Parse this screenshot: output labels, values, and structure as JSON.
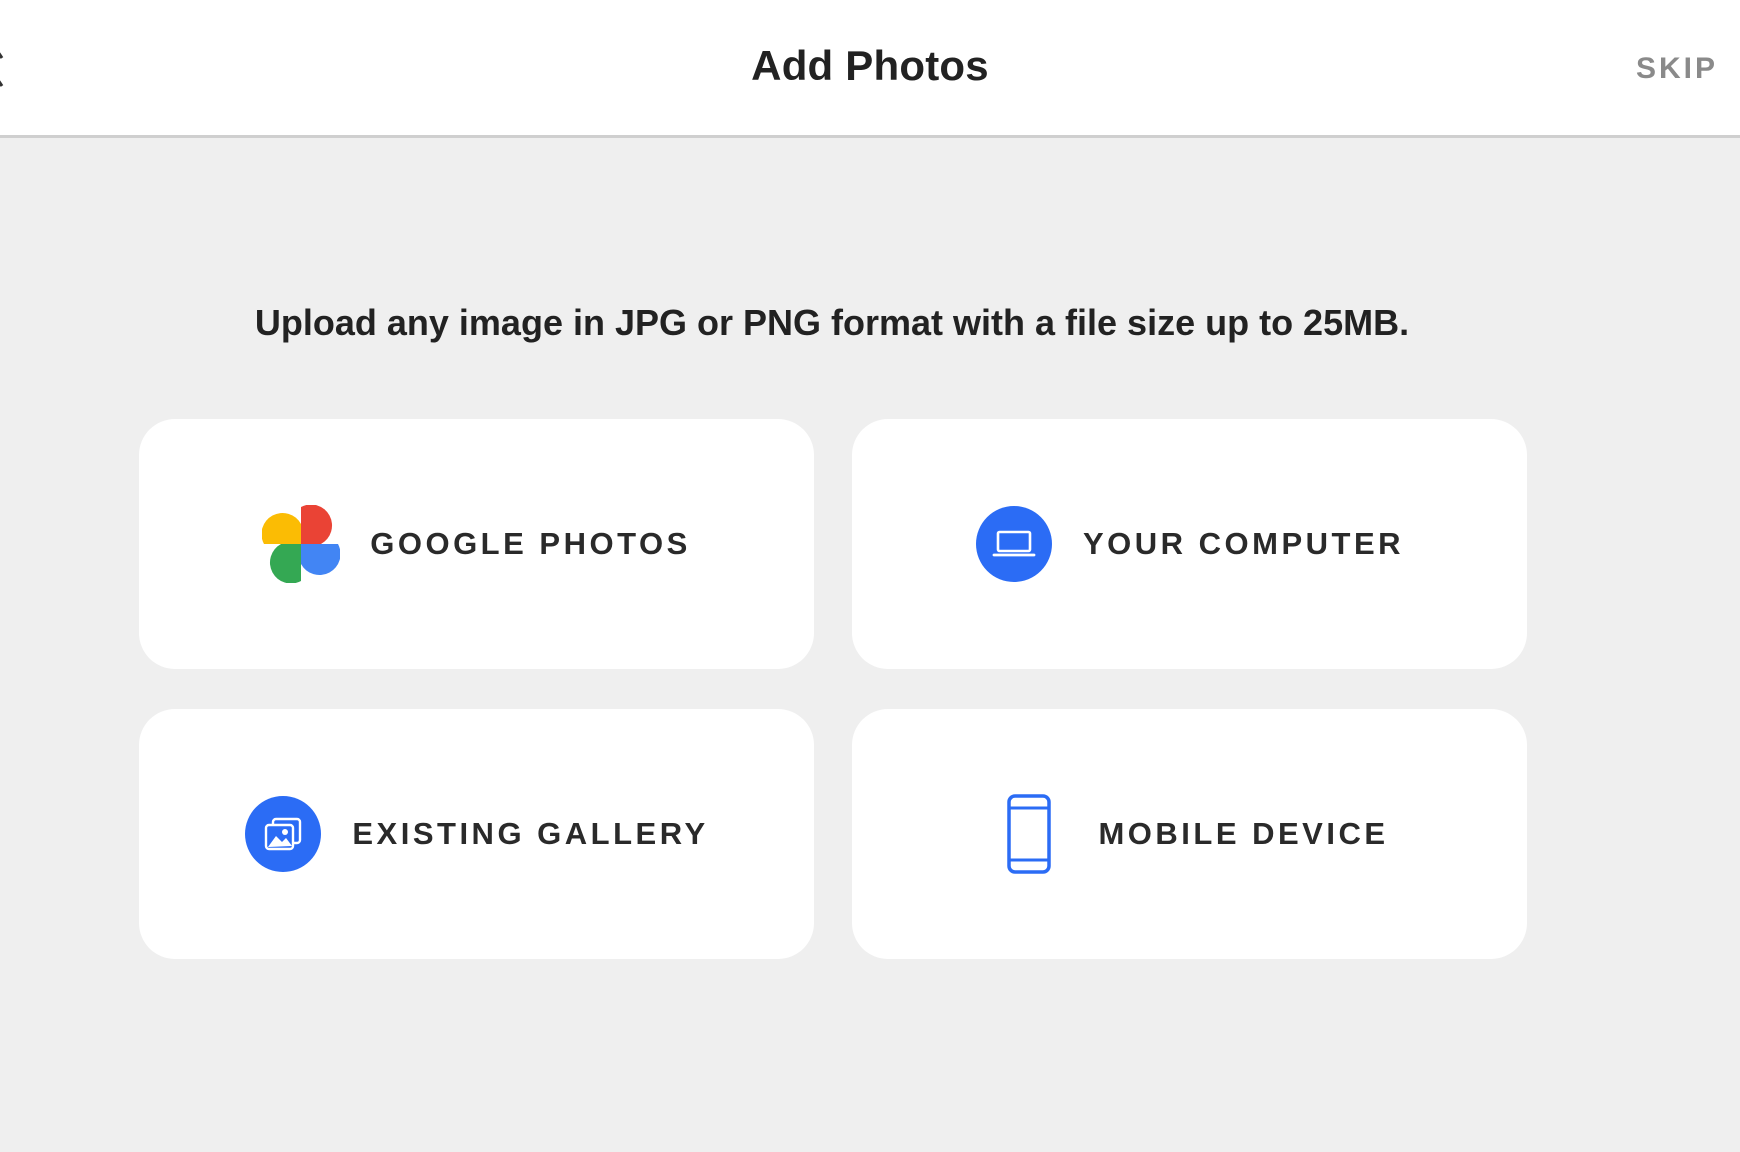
{
  "header": {
    "title": "Add Photos",
    "skip_label": "SKIP"
  },
  "instruction": "Upload any image in JPG or PNG format with a file size up to 25MB.",
  "options": [
    {
      "label": "GOOGLE PHOTOS",
      "icon": "google-photos-pinwheel-icon"
    },
    {
      "label": "YOUR COMPUTER",
      "icon": "laptop-icon"
    },
    {
      "label": "EXISTING GALLERY",
      "icon": "image-gallery-icon"
    },
    {
      "label": "MOBILE DEVICE",
      "icon": "mobile-phone-icon"
    }
  ],
  "colors": {
    "accent_blue": "#2b6cf5",
    "background": "#efefef",
    "card": "#ffffff",
    "skip_text": "#8a8a8a",
    "google_red": "#ea4335",
    "google_yellow": "#fbbc04",
    "google_green": "#34a853",
    "google_blue": "#4285f4"
  }
}
